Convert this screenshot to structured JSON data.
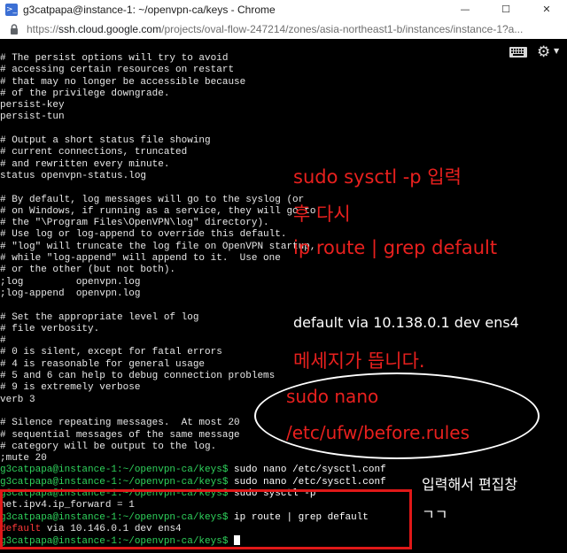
{
  "window": {
    "title": "g3catpapa@instance-1: ~/openvpn-ca/keys - Chrome",
    "controls": {
      "minimize": "—",
      "maximize": "☐",
      "close": "✕"
    }
  },
  "address": {
    "url_prefix": "https://",
    "url_host": "ssh.cloud.google.com",
    "url_path": "/projects/oval-flow-247214/zones/asia-northeast1-b/instances/instance-1?a..."
  },
  "terminal": {
    "prompt": "g3catpapa@instance-1:~/openvpn-ca/keys$",
    "lines": [
      {
        "type": "text",
        "text": "# The persist options will try to avoid"
      },
      {
        "type": "text",
        "text": "# accessing certain resources on restart"
      },
      {
        "type": "text",
        "text": "# that may no longer be accessible because"
      },
      {
        "type": "text",
        "text": "# of the privilege downgrade."
      },
      {
        "type": "text",
        "text": "persist-key"
      },
      {
        "type": "text",
        "text": "persist-tun"
      },
      {
        "type": "text",
        "text": ""
      },
      {
        "type": "text",
        "text": "# Output a short status file showing"
      },
      {
        "type": "text",
        "text": "# current connections, truncated"
      },
      {
        "type": "text",
        "text": "# and rewritten every minute."
      },
      {
        "type": "text",
        "text": "status openvpn-status.log"
      },
      {
        "type": "text",
        "text": ""
      },
      {
        "type": "text",
        "text": "# By default, log messages will go to the syslog (or"
      },
      {
        "type": "text",
        "text": "# on Windows, if running as a service, they will go to"
      },
      {
        "type": "text",
        "text": "# the \"\\Program Files\\OpenVPN\\log\" directory)."
      },
      {
        "type": "text",
        "text": "# Use log or log-append to override this default."
      },
      {
        "type": "text",
        "text": "# \"log\" will truncate the log file on OpenVPN startup,"
      },
      {
        "type": "text",
        "text": "# while \"log-append\" will append to it.  Use one"
      },
      {
        "type": "text",
        "text": "# or the other (but not both)."
      },
      {
        "type": "text",
        "text": ";log         openvpn.log"
      },
      {
        "type": "text",
        "text": ";log-append  openvpn.log"
      },
      {
        "type": "text",
        "text": ""
      },
      {
        "type": "text",
        "text": "# Set the appropriate level of log"
      },
      {
        "type": "text",
        "text": "# file verbosity."
      },
      {
        "type": "text",
        "text": "#"
      },
      {
        "type": "text",
        "text": "# 0 is silent, except for fatal errors"
      },
      {
        "type": "text",
        "text": "# 4 is reasonable for general usage"
      },
      {
        "type": "text",
        "text": "# 5 and 6 can help to debug connection problems"
      },
      {
        "type": "text",
        "text": "# 9 is extremely verbose"
      },
      {
        "type": "text",
        "text": "verb 3"
      },
      {
        "type": "text",
        "text": ""
      },
      {
        "type": "text",
        "text": "# Silence repeating messages.  At most 20"
      },
      {
        "type": "text",
        "text": "# sequential messages of the same message"
      },
      {
        "type": "text",
        "text": "# category will be output to the log."
      },
      {
        "type": "text",
        "text": ";mute 20"
      },
      {
        "type": "prompt",
        "text": " sudo nano /etc/sysctl.conf"
      },
      {
        "type": "prompt",
        "text": " sudo nano /etc/sysctl.conf"
      },
      {
        "type": "prompt",
        "text": " sudo sysctl -p"
      },
      {
        "type": "text",
        "text": "net.ipv4.ip_forward = 1"
      },
      {
        "type": "prompt",
        "text": " ip route | grep default"
      },
      {
        "type": "highlight",
        "keyword": "default",
        "text": " via 10.146.0.1 dev ens4"
      },
      {
        "type": "cursor",
        "text": " "
      }
    ]
  },
  "annotations": {
    "step1": "sudo sysctl -p 입력",
    "step2": "후 다시",
    "step3": "ip route | grep default",
    "result": "default via 10.138.0.1 dev ens4",
    "result_note": "메세지가 뜹니다.",
    "edit_cmd1": "sudo nano",
    "edit_cmd2": "/etc/ufw/before.rules",
    "edit_note1": "입력해서 편집창",
    "edit_note2": "ㄱㄱ"
  },
  "colors": {
    "prompt": "#2fd35c",
    "annotation_red": "#e8201e",
    "highlight_box": "#e01818",
    "terminal_bg": "#000000"
  },
  "icons": [
    "chrome-app-icon",
    "lock-icon",
    "keyboard-icon",
    "gear-icon"
  ]
}
